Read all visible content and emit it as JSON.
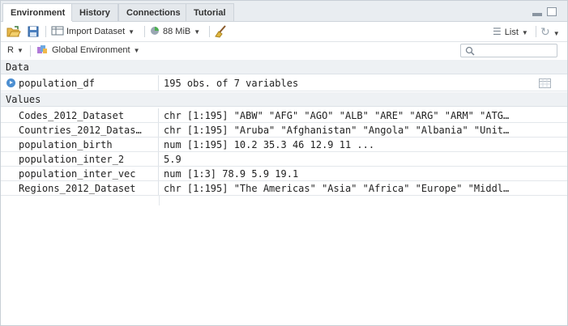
{
  "tabs": [
    "Environment",
    "History",
    "Connections",
    "Tutorial"
  ],
  "toolbar": {
    "import_label": "Import Dataset",
    "memory_label": "88 MiB",
    "view_label": "List",
    "language_label": "R",
    "env_label": "Global Environment",
    "search_placeholder": ""
  },
  "sections": {
    "data_header": "Data",
    "values_header": "Values"
  },
  "data_rows": [
    {
      "name": "population_df",
      "value": "195 obs. of 7 variables"
    }
  ],
  "value_rows": [
    {
      "name": "Codes_2012_Dataset",
      "value": "chr [1:195] \"ABW\" \"AFG\" \"AGO\" \"ALB\" \"ARE\" \"ARG\" \"ARM\" \"ATG…"
    },
    {
      "name": "Countries_2012_Datas…",
      "value": "chr [1:195] \"Aruba\" \"Afghanistan\" \"Angola\" \"Albania\" \"Unit…"
    },
    {
      "name": "population_birth",
      "value": "num [1:195] 10.2 35.3 46 12.9 11 ..."
    },
    {
      "name": "population_inter_2",
      "value": "5.9"
    },
    {
      "name": "population_inter_vec",
      "value": "num [1:3] 78.9 5.9 19.1"
    },
    {
      "name": "Regions_2012_Dataset",
      "value": "chr [1:195] \"The Americas\" \"Asia\" \"Africa\" \"Europe\" \"Middl…"
    }
  ],
  "colors": {
    "accent": "#4d8fd1",
    "tab_bg": "#e9edf1"
  }
}
